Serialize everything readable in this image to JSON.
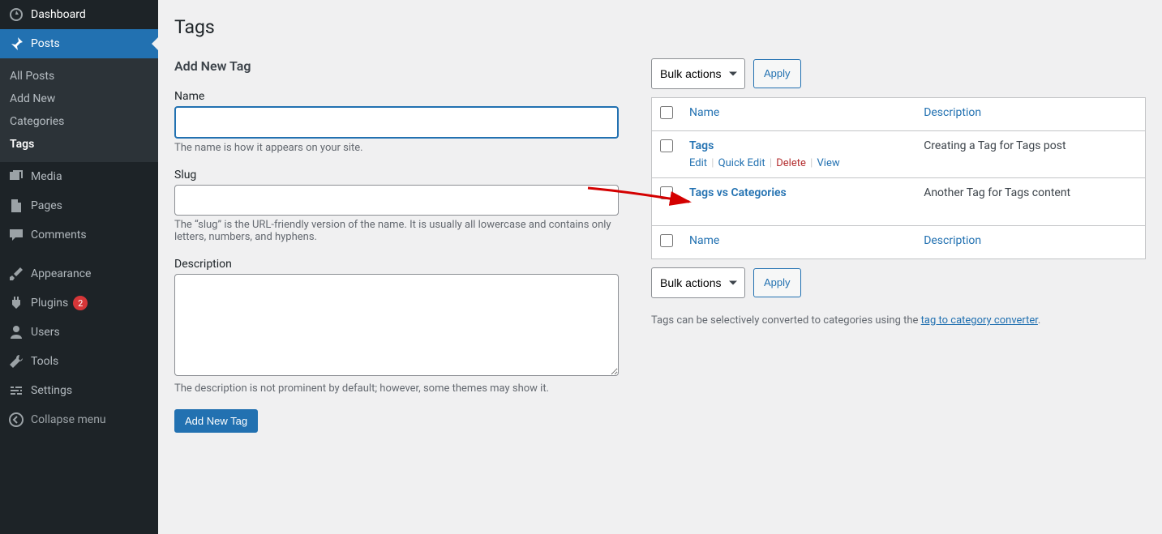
{
  "sidebar": {
    "dashboard": "Dashboard",
    "posts": "Posts",
    "posts_sub": [
      "All Posts",
      "Add New",
      "Categories",
      "Tags"
    ],
    "media": "Media",
    "pages": "Pages",
    "comments": "Comments",
    "appearance": "Appearance",
    "plugins": "Plugins",
    "plugins_badge": "2",
    "users": "Users",
    "tools": "Tools",
    "settings": "Settings",
    "collapse": "Collapse menu"
  },
  "page": {
    "title": "Tags"
  },
  "form": {
    "heading": "Add New Tag",
    "name_label": "Name",
    "name_help": "The name is how it appears on your site.",
    "slug_label": "Slug",
    "slug_help": "The “slug” is the URL-friendly version of the name. It is usually all lowercase and contains only letters, numbers, and hyphens.",
    "desc_label": "Description",
    "desc_help": "The description is not prominent by default; however, some themes may show it.",
    "submit": "Add New Tag"
  },
  "bulk": {
    "label": "Bulk actions",
    "apply": "Apply"
  },
  "table": {
    "col_name": "Name",
    "col_desc": "Description",
    "rows": [
      {
        "name": "Tags",
        "desc": "Creating a Tag for Tags post"
      },
      {
        "name": "Tags vs Categories",
        "desc": "Another Tag for Tags content"
      }
    ],
    "actions": {
      "edit": "Edit",
      "quick": "Quick Edit",
      "delete": "Delete",
      "view": "View"
    }
  },
  "footer_note": {
    "pre": "Tags can be selectively converted to categories using the ",
    "link": "tag to category converter",
    "post": "."
  }
}
